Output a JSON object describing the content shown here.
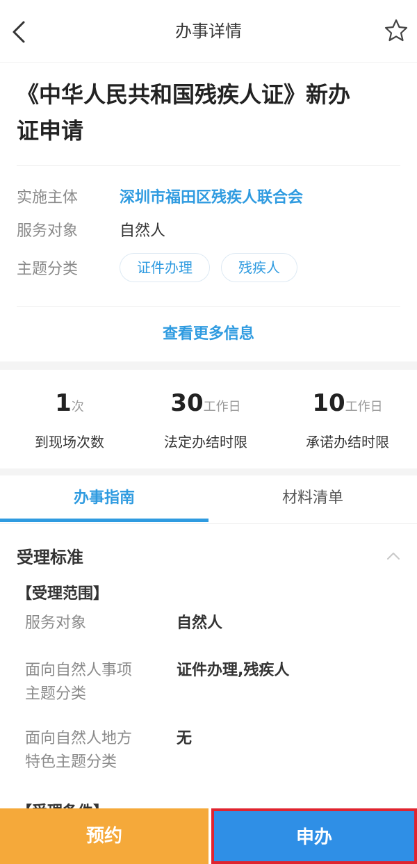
{
  "header": {
    "title": "办事详情",
    "back_icon": "chevron-left-icon",
    "favorite_icon": "star-outline-icon"
  },
  "item": {
    "title_line1": "《中华人民共和国残疾人证》新办",
    "title_line2": "证申请"
  },
  "info": {
    "agency_label": "实施主体",
    "agency_value": "深圳市福田区残疾人联合会",
    "target_label": "服务对象",
    "target_value": "自然人",
    "topic_label": "主题分类",
    "topic_tags": [
      "证件办理",
      "残疾人"
    ]
  },
  "more_info": "查看更多信息",
  "stats": [
    {
      "value": "1",
      "unit": "次",
      "label": "到现场次数"
    },
    {
      "value": "30",
      "unit": "工作日",
      "label": "法定办结时限"
    },
    {
      "value": "10",
      "unit": "工作日",
      "label": "承诺办结时限"
    }
  ],
  "tabs": [
    {
      "label": "办事指南",
      "active": true
    },
    {
      "label": "材料清单",
      "active": false
    }
  ],
  "section": {
    "title": "受理标准",
    "subhead_scope": "【受理范围】",
    "rows": [
      {
        "label": "服务对象",
        "value": "自然人"
      },
      {
        "label_line1": "面向自然人事项",
        "label_line2": "主题分类",
        "value": "证件办理,残疾人"
      },
      {
        "label_line1": "面向自然人地方",
        "label_line2": "特色主题分类",
        "value": "无"
      }
    ],
    "subhead_conditions": "【受理条件】"
  },
  "actions": {
    "reserve": "预约",
    "apply": "申办"
  },
  "colors": {
    "accent": "#2f9be0",
    "reserve_bg": "#f5a93a",
    "apply_bg": "#2f8fe6",
    "highlight_border": "#e0242f"
  }
}
